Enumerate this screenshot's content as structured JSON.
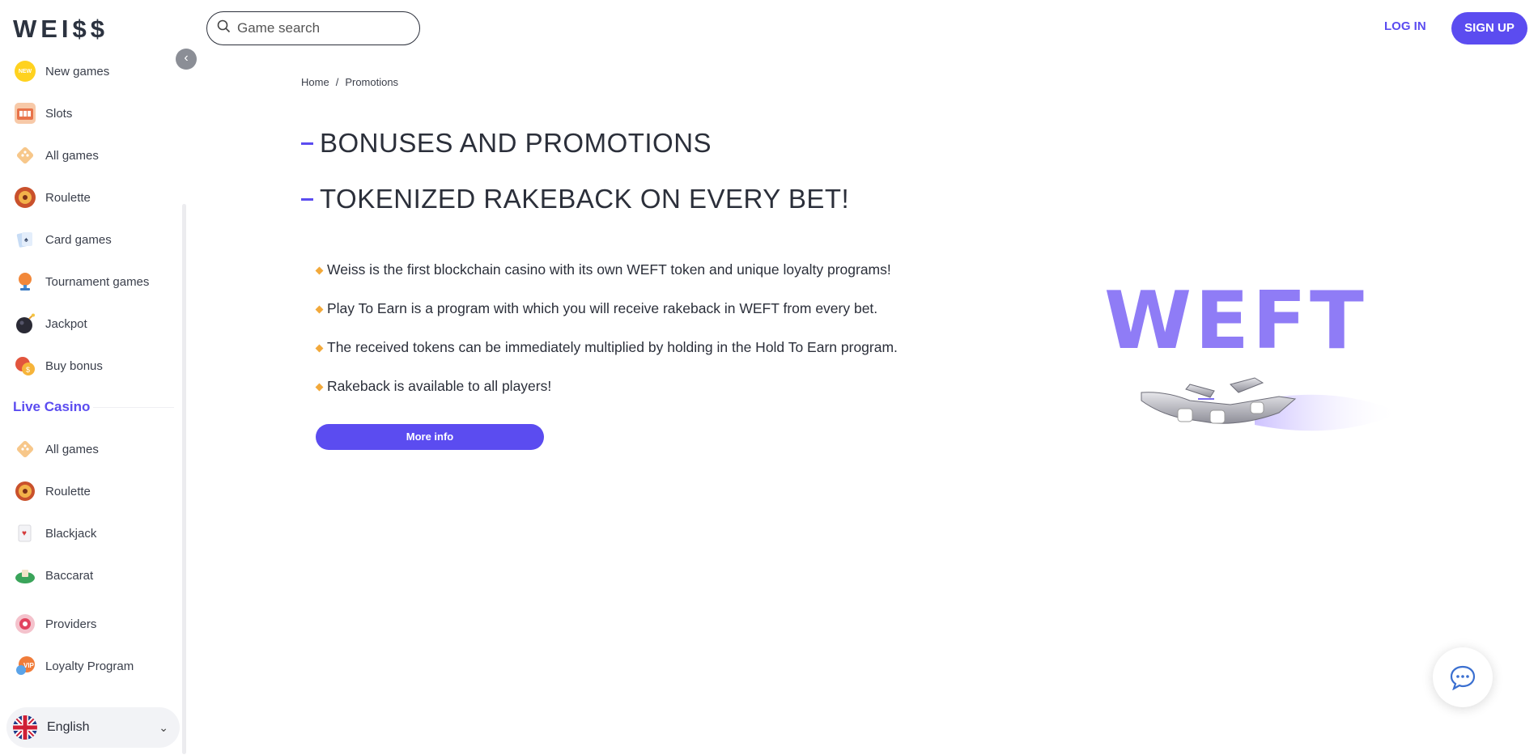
{
  "brand": {
    "logo_text": "WEI$$"
  },
  "header": {
    "search_placeholder": "Game search",
    "login_label": "LOG IN",
    "signup_label": "SIGN UP"
  },
  "sidebar": {
    "casino_items": [
      {
        "label": "New games",
        "icon": "new-badge-icon"
      },
      {
        "label": "Slots",
        "icon": "slot-machine-icon"
      },
      {
        "label": "All games",
        "icon": "dice-icon"
      },
      {
        "label": "Roulette",
        "icon": "roulette-icon"
      },
      {
        "label": "Card games",
        "icon": "cards-icon"
      },
      {
        "label": "Tournament games",
        "icon": "trophy-icon"
      },
      {
        "label": "Jackpot",
        "icon": "bomb-icon"
      },
      {
        "label": "Buy bonus",
        "icon": "bonus-icon"
      }
    ],
    "live_casino_title": "Live Casino",
    "live_items": [
      {
        "label": "All games",
        "icon": "dice-icon"
      },
      {
        "label": "Roulette",
        "icon": "roulette-icon"
      },
      {
        "label": "Blackjack",
        "icon": "blackjack-icon"
      },
      {
        "label": "Baccarat",
        "icon": "baccarat-icon"
      }
    ],
    "extra_items": [
      {
        "label": "Providers",
        "icon": "providers-icon"
      },
      {
        "label": "Loyalty Program",
        "icon": "loyalty-icon"
      }
    ],
    "language": "English"
  },
  "breadcrumb": {
    "home": "Home",
    "separator": "/",
    "current": "Promotions"
  },
  "main": {
    "heading1": "BONUSES AND PROMOTIONS",
    "heading2": "TOKENIZED RAKEBACK ON EVERY BET!",
    "bullets": [
      "Weiss is the first blockchain casino with its own WEFT token and unique loyalty programs!",
      "Play To Earn is a program with which you will receive rakeback in WEFT from every bet.",
      "The received tokens can be immediately multiplied by holding in the Hold To Earn program.",
      "Rakeback is available to all players!"
    ],
    "more_info_label": "More info",
    "promo_art_text": "WEFT"
  },
  "colors": {
    "accent": "#5b4cf0",
    "weft": "#8f7cf6",
    "bullet": "#f2a93b"
  }
}
